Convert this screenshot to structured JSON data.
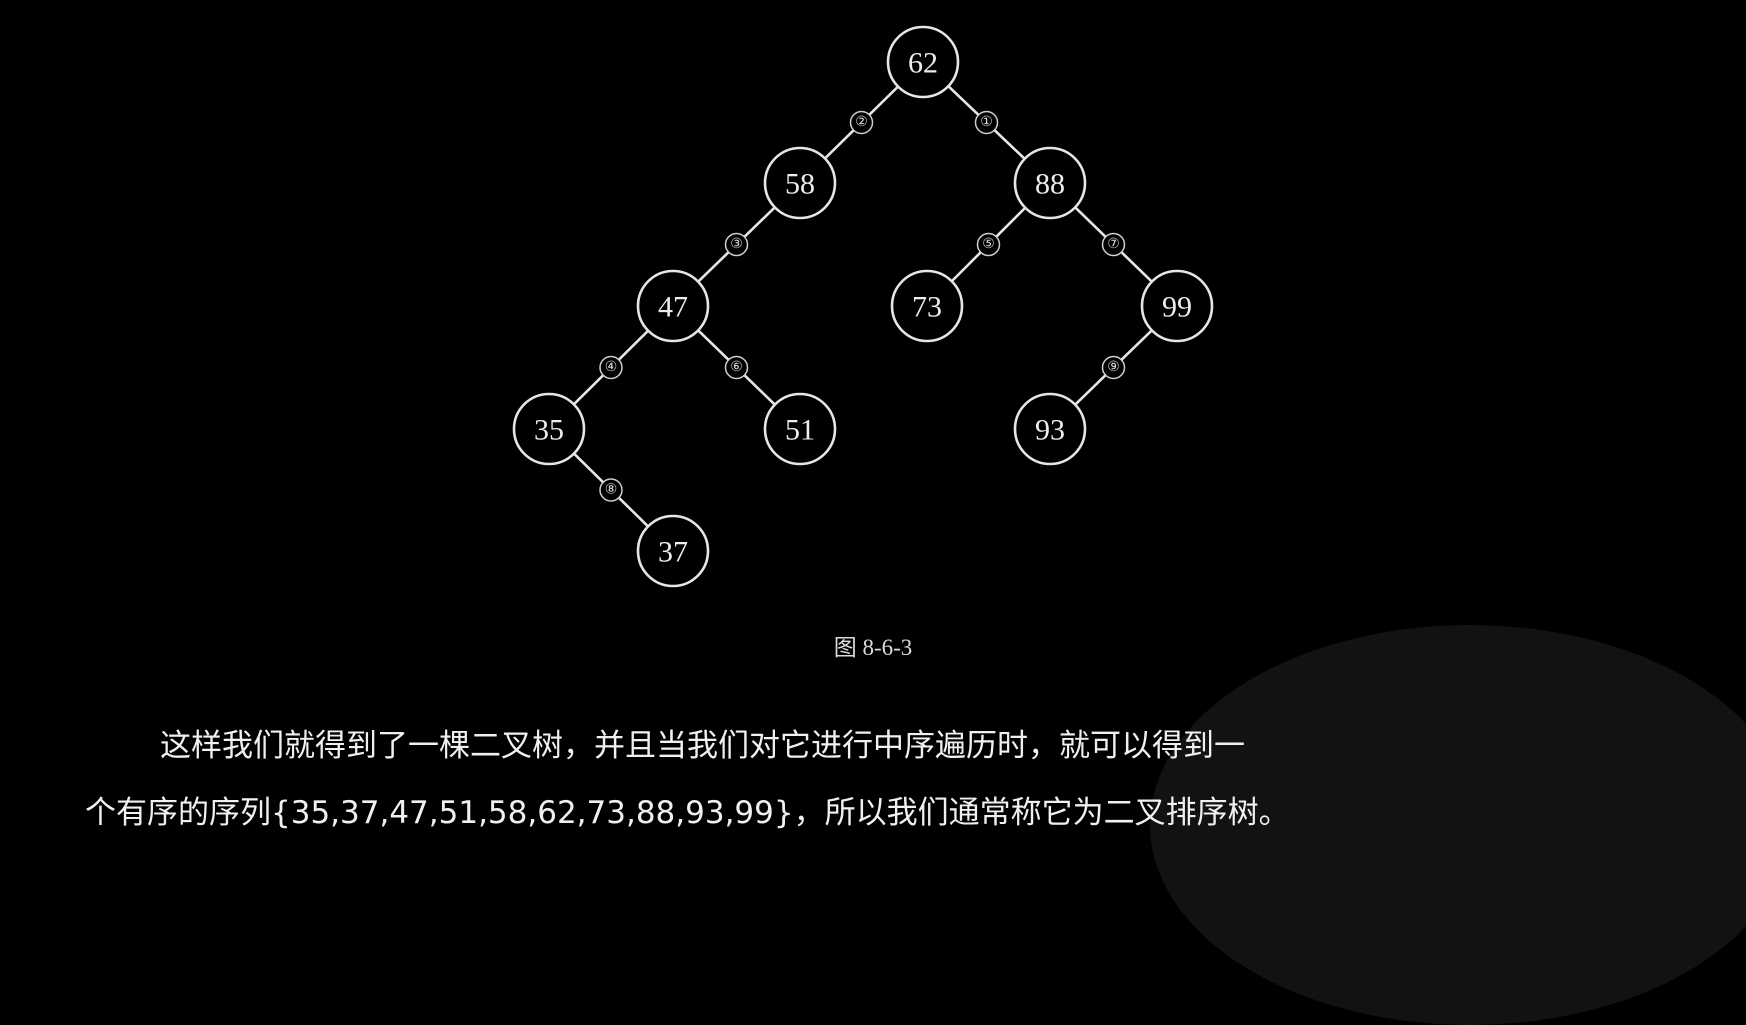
{
  "figure": {
    "caption": "图 8-6-3",
    "nodes": [
      {
        "id": "n62",
        "label": "62"
      },
      {
        "id": "n58",
        "label": "58"
      },
      {
        "id": "n88",
        "label": "88"
      },
      {
        "id": "n47",
        "label": "47"
      },
      {
        "id": "n73",
        "label": "73"
      },
      {
        "id": "n99",
        "label": "99"
      },
      {
        "id": "n35",
        "label": "35"
      },
      {
        "id": "n51",
        "label": "51"
      },
      {
        "id": "n93",
        "label": "93"
      },
      {
        "id": "n37",
        "label": "37"
      }
    ],
    "edges": [
      {
        "from": "n62",
        "to": "n58",
        "step": "②"
      },
      {
        "from": "n62",
        "to": "n88",
        "step": "①"
      },
      {
        "from": "n58",
        "to": "n47",
        "step": "③"
      },
      {
        "from": "n88",
        "to": "n73",
        "step": "⑤"
      },
      {
        "from": "n88",
        "to": "n99",
        "step": "⑦"
      },
      {
        "from": "n47",
        "to": "n35",
        "step": "④"
      },
      {
        "from": "n47",
        "to": "n51",
        "step": "⑥"
      },
      {
        "from": "n99",
        "to": "n93",
        "step": "⑨"
      },
      {
        "from": "n35",
        "to": "n37",
        "step": "⑧"
      }
    ]
  },
  "paragraph": {
    "line1": "这样我们就得到了一棵二叉树，并且当我们对它进行中序遍历时，就可以得到一",
    "line2": "个有序的序列{35,37,47,51,58,62,73,88,93,99}，所以我们通常称它为二叉排序树。"
  }
}
